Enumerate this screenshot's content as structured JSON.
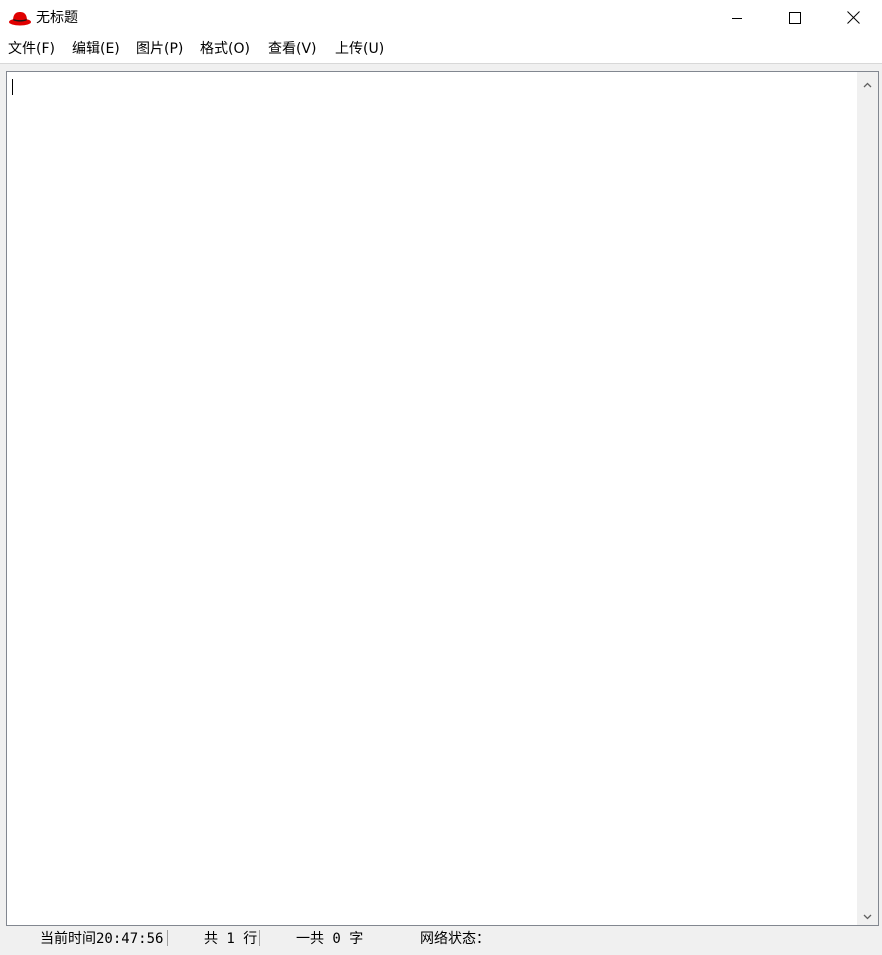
{
  "window": {
    "title": "无标题",
    "app_icon": "red-hat-icon",
    "controls": {
      "minimize": "minimize-icon",
      "maximize": "maximize-icon",
      "close": "close-icon"
    }
  },
  "menu": {
    "items": [
      {
        "label": "文件(F)"
      },
      {
        "label": "编辑(E)"
      },
      {
        "label": "图片(P)"
      },
      {
        "label": "格式(O)"
      },
      {
        "label": "查看(V)"
      },
      {
        "label": "上传(U)"
      }
    ]
  },
  "editor": {
    "content": ""
  },
  "status": {
    "time_label": "当前时间20:47:56",
    "lines_label": "共 1 行",
    "chars_label": "一共 0 字",
    "network_label": "网络状态："
  },
  "colors": {
    "icon_red": "#e00000",
    "chrome": "#f0f0f0",
    "editor_border": "#828790"
  }
}
